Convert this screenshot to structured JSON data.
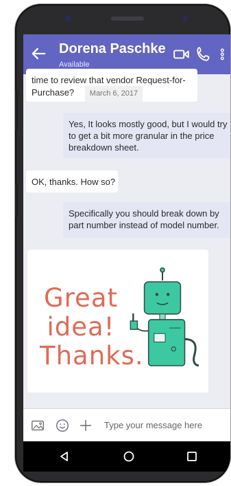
{
  "contact": {
    "name": "Dorena Paschke",
    "status": "Available"
  },
  "messages": [
    {
      "id": "m1",
      "type": "incoming",
      "text_lines": [
        "time to review that vendor Request-for-",
        "Purchase?"
      ],
      "date": "March 6, 2017"
    },
    {
      "id": "m2",
      "type": "outgoing",
      "text": "Yes, It looks mostly good, but I would try to get a bit more granular in the price breakdown sheet."
    },
    {
      "id": "m3",
      "type": "incoming",
      "text": "OK, thanks. How so?"
    },
    {
      "id": "m4",
      "type": "outgoing",
      "text": "Specifically you should break down by part number instead of model number."
    }
  ],
  "sticker": {
    "lines": [
      "Great",
      "idea!",
      "Thanks."
    ],
    "icon": "robot-thumbs-up"
  },
  "composer": {
    "placeholder": "Type your message here"
  },
  "icons": {
    "back": "arrow-left-icon",
    "video": "video-call-icon",
    "call": "phone-call-icon",
    "more": "more-vertical-icon",
    "image": "image-icon",
    "emoji": "emoji-icon",
    "add": "plus-icon",
    "nav_back": "triangle-back-icon",
    "nav_home": "circle-home-icon",
    "nav_recent": "square-recent-icon"
  },
  "colors": {
    "header": "#6265c2",
    "bubble_out": "#e5e6f4",
    "bubble_in": "#ffffff",
    "sticker_text": "#e16a55",
    "robot": "#3cc8a0"
  }
}
